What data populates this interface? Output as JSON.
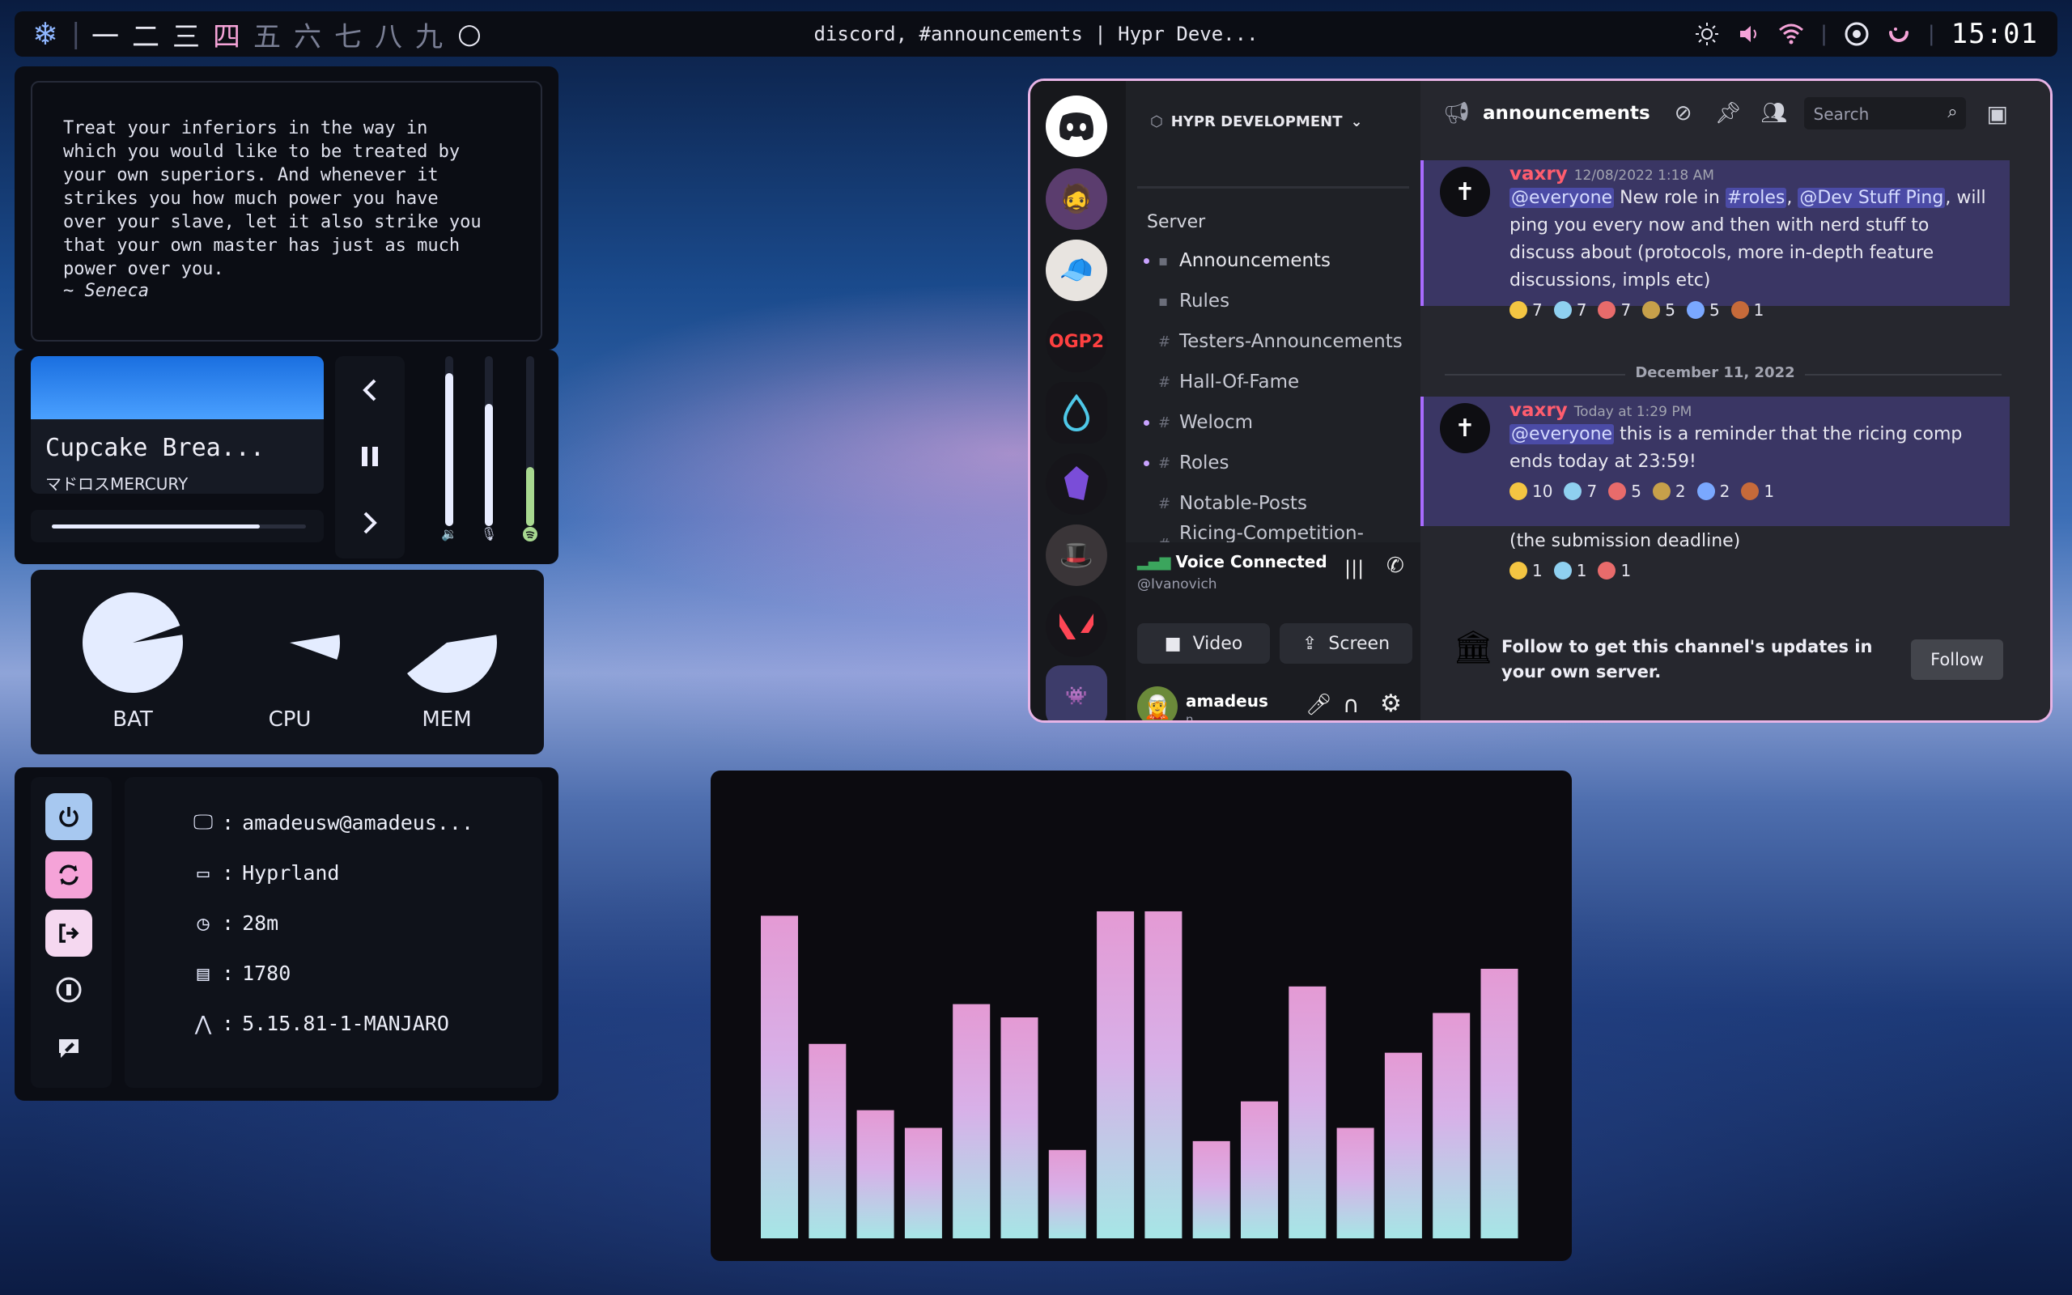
{
  "topbar": {
    "workspaces": [
      "一",
      "二",
      "三",
      "四",
      "五",
      "六",
      "七",
      "八",
      "九"
    ],
    "active_workspace": "四",
    "window_title": "discord, #announcements | Hypr Deve...",
    "clock": "15:01"
  },
  "quote": {
    "text": "Treat your inferiors in the way in\nwhich you would like to be treated by\nyour own superiors. And whenever it\nstrikes you how much power you have\nover your slave, let it also strike you\nthat your own master has just as much\npower over you.",
    "author": "~ Seneca"
  },
  "media": {
    "song": "Cupcake Brea...",
    "artist": "マドロスMERCURY",
    "progress": 0.82,
    "volume_levels": {
      "speaker": 0.9,
      "mic": 0.72,
      "spotify": 0.35
    }
  },
  "stats": {
    "gauges": [
      {
        "label": "BAT",
        "value": 0.97
      },
      {
        "label": "CPU",
        "value": 0.08
      },
      {
        "label": "MEM",
        "value": 0.42
      }
    ]
  },
  "sysinfo": {
    "user": "amadeusw@amadeus...",
    "wm": "Hyprland",
    "uptime": "28m",
    "packages": "1780",
    "kernel": "5.15.81-1-MANJARO"
  },
  "discord": {
    "server_name": "HYPR DEVELOPMENT",
    "category": "Server",
    "channels": [
      {
        "name": "Announcements",
        "unread": true
      },
      {
        "name": "Rules",
        "unread": false
      },
      {
        "name": "Testers-Announcements",
        "unread": false
      },
      {
        "name": "Hall-Of-Fame",
        "unread": false
      },
      {
        "name": "Welocm",
        "unread": true
      },
      {
        "name": "Roles",
        "unread": true
      },
      {
        "name": "Notable-Posts",
        "unread": false
      },
      {
        "name": "Ricing-Competition-Submi",
        "unread": false
      }
    ],
    "voice": {
      "status": "Voice Connected",
      "channel": "@Ivanovich",
      "video_label": "Video",
      "screen_label": "Screen"
    },
    "user": {
      "name": "amadeus",
      "tag": "n"
    },
    "channel_title": "announcements",
    "search_placeholder": "Search",
    "messages": [
      {
        "author": "vaxry",
        "timestamp": "12/08/2022 1:18 AM",
        "mention": "@everyone",
        "text_a": " New role in ",
        "channel_mention": "#roles",
        "text_b": ", ",
        "role_mention": "@Dev Stuff Ping",
        "text_c": ", will ping you every now and then with nerd stuff to discuss about (protocols, more in-depth feature discussions, impls etc)",
        "reactions": [
          "7",
          "7",
          "7",
          "5",
          "5",
          "1"
        ]
      },
      {
        "author": "vaxry",
        "timestamp": "Today at 1:29 PM",
        "mention": "@everyone",
        "text": " this is a reminder that the ricing comp ends today at 23:59!",
        "reactions": [
          "10",
          "7",
          "5",
          "2",
          "2",
          "1"
        ]
      },
      {
        "text": "(the submission deadline)",
        "reactions": [
          "1",
          "1",
          "1"
        ]
      }
    ],
    "date_divider": "December 11, 2022",
    "follow_text": "Follow to get this channel's updates in your own server.",
    "follow_button": "Follow",
    "guild_label_ogp": "OGP2"
  },
  "visualizer": {
    "bars": [
      0.73,
      0.44,
      0.29,
      0.25,
      0.53,
      0.5,
      0.2,
      0.74,
      0.74,
      0.22,
      0.31,
      0.57,
      0.25,
      0.42,
      0.51,
      0.61
    ]
  },
  "colors": {
    "accent_pink": "#f5a3d8",
    "bar_top": "#e49ad4",
    "bar_bottom": "#a6e6e6"
  }
}
